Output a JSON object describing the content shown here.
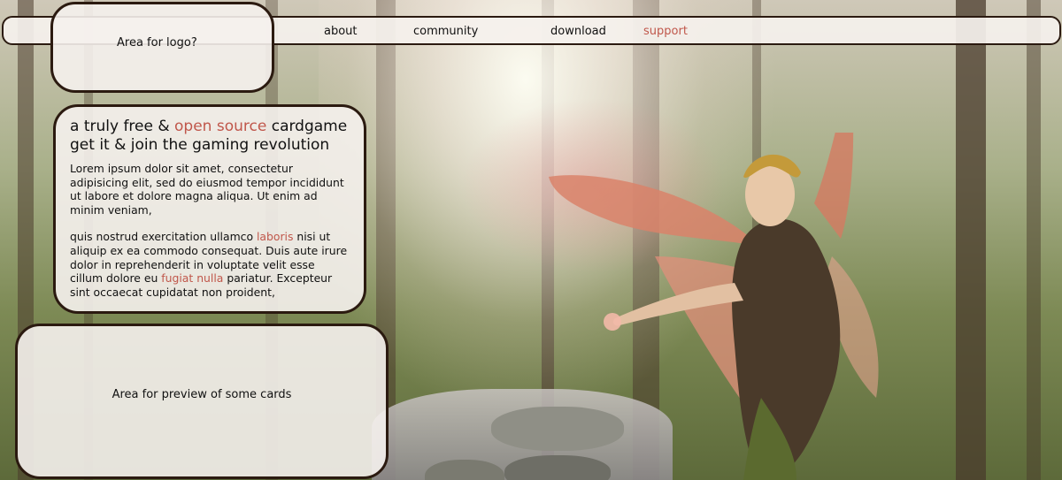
{
  "nav": {
    "about": "about",
    "community": "community",
    "download": "download",
    "support": "support",
    "support_color": "#c0574b"
  },
  "logo_area": {
    "label": "Area for logo?"
  },
  "intro": {
    "headline_part1": "a truly free & ",
    "headline_accent": "open source",
    "headline_part2": " cardgame",
    "headline_line2": "get it & join the gaming revolution",
    "paragraph1": "Lorem ipsum dolor sit amet, consectetur adipisicing elit, sed do eiusmod tempor incididunt ut labore et dolore magna aliqua. Ut enim ad minim veniam,",
    "p2_part1": "quis nostrud exercitation ullamco ",
    "p2_link1": "laboris",
    "p2_part2": " nisi ut aliquip ex ea commodo consequat. Duis aute irure dolor in reprehenderit in voluptate velit esse cillum dolore eu ",
    "p2_link2": "fugiat nulla",
    "p2_part3": " pariatur. Excepteur sint occaecat cupidatat non proident,"
  },
  "preview_area": {
    "label": "Area for preview of some cards"
  },
  "colors": {
    "accent": "#c0574b",
    "panel_border": "#2b1a10",
    "panel_fill": "#f5f1ed"
  },
  "icons": {
    "background": "forest-fairy-illustration"
  }
}
